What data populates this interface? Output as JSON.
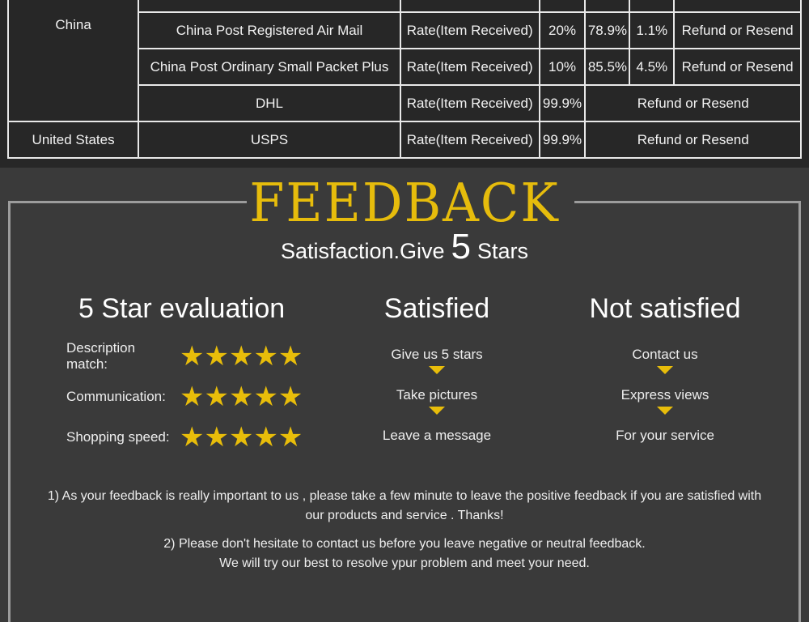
{
  "shipping_table": {
    "rows": [
      {
        "country": "China",
        "method": "China Post Registered Air Mail",
        "rate_label": "Rate(Item Received)",
        "v1": "20%",
        "v2": "78.9%",
        "v3": "1.1%",
        "policy": "Refund or Resend"
      },
      {
        "method": "China Post Ordinary Small Packet Plus",
        "rate_label": "Rate(Item Received)",
        "v1": "10%",
        "v2": "85.5%",
        "v3": "4.5%",
        "policy": "Refund or Resend"
      },
      {
        "method": "DHL",
        "rate_label": "Rate(Item Received)",
        "v1": "99.9%",
        "policy": "Refund or Resend"
      },
      {
        "country": "United States",
        "method": "USPS",
        "rate_label": "Rate(Item Received)",
        "v1": "99.9%",
        "policy": "Refund or Resend"
      }
    ]
  },
  "feedback": {
    "title": "FEEDBACK",
    "subtitle_pre": "Satisfaction.Give",
    "subtitle_num": "5",
    "subtitle_post": "Stars",
    "five_star": {
      "heading": "5 Star evaluation",
      "items": [
        {
          "label": "Description match:",
          "stars": 5
        },
        {
          "label": "Communication:",
          "stars": 5
        },
        {
          "label": "Shopping speed:",
          "stars": 5
        }
      ]
    },
    "satisfied": {
      "heading": "Satisfied",
      "steps": [
        "Give us 5 stars",
        "Take pictures",
        "Leave a message"
      ]
    },
    "not_satisfied": {
      "heading": "Not satisfied",
      "steps": [
        "Contact us",
        "Express views",
        "For your service"
      ]
    },
    "note1_line1": "1) As your feedback is really important to us , please take a few minute to leave the positive feedback if you are satisfied with",
    "note1_line2": "our products and service . Thanks!",
    "note2_line1": "2) Please don't hesitate to contact us before you leave negative or neutral feedback.",
    "note2_line2": "We will try our best to resolve ypur problem and meet your need.",
    "star_color": "#e8bd0a",
    "title_color": "#e6bc0c"
  }
}
